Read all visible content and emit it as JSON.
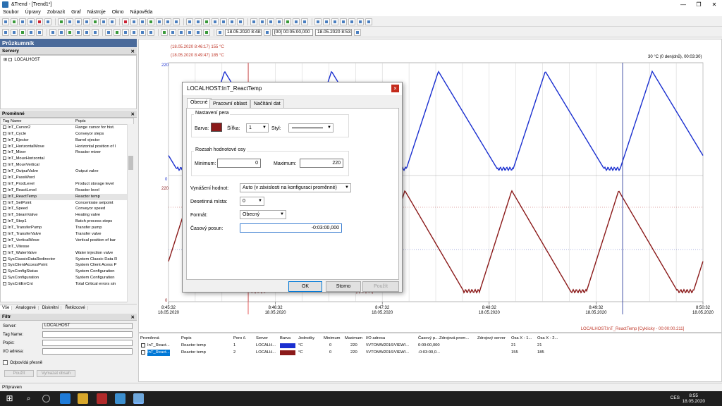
{
  "window": {
    "title": "&Trend - [Trend1*]"
  },
  "menu": [
    "Soubor",
    "Úpravy",
    "Zobrazit",
    "Graf",
    "Nástroje",
    "Okno",
    "Nápověda"
  ],
  "toolbar2": {
    "start_time": "18.05.2020   8:48:32",
    "range": "[00] 00:05:00,000",
    "end_time": "18.05.2020   8:53:32"
  },
  "explorer": {
    "title": "Průzkumník",
    "servers_label": "Servery",
    "server_item": "LOCALHOST",
    "variables_label": "Proměnné",
    "columns": [
      "Tag Name",
      "Popis"
    ],
    "rows": [
      [
        "InT_Cursor2",
        "Range cursor for hist."
      ],
      [
        "InT_Cycle",
        "Conveyor steps"
      ],
      [
        "InT_Ejector",
        "Barrel ejector"
      ],
      [
        "InT_HorizontalMove",
        "Horizontal position of l"
      ],
      [
        "InT_Mixer",
        "Reactor mixer"
      ],
      [
        "InT_MouvHorizontal",
        ""
      ],
      [
        "InT_MouvVertical",
        ""
      ],
      [
        "InT_OutputValve",
        "Output valve"
      ],
      [
        "InT_PassWord",
        ""
      ],
      [
        "InT_ProdLevel",
        "Product storage level"
      ],
      [
        "InT_ReactLevel",
        "Reactor level"
      ],
      [
        "InT_ReactTemp",
        "Reactor temp"
      ],
      [
        "InT_SetPoint",
        "Concentrate setpoint"
      ],
      [
        "InT_Speed",
        "Conveyor speed"
      ],
      [
        "InT_SteamValve",
        "Heating valve"
      ],
      [
        "InT_Step1",
        "Batch process steps"
      ],
      [
        "InT_TransferPump",
        "Transfer pump"
      ],
      [
        "InT_TransferValve",
        "Transfer valve"
      ],
      [
        "InT_VerticalMove",
        "Vertical position of bar"
      ],
      [
        "InT_Vitesse",
        ""
      ],
      [
        "InT_WaterValve",
        "Water injection valve"
      ],
      [
        "SysClassicDataRedirector",
        "System Classic Data R"
      ],
      [
        "SysClientAccessPoint",
        "System Client Acess P"
      ],
      [
        "SysConfigStatus",
        "System Configuration"
      ],
      [
        "SysConfiguration",
        "System Configuration"
      ],
      [
        "SysCritErrCnt",
        "Total Critical errors sin"
      ]
    ],
    "selected_index": 11,
    "tabs": [
      "Vše",
      "Analogové",
      "Diskrétní",
      "Řetězcové"
    ]
  },
  "filter": {
    "title": "Filtr",
    "server_label": "Server:",
    "server_value": "LOCALHOST",
    "tagname_label": "Tag Name:",
    "desc_label": "Popis:",
    "io_label": "I/O adresa:",
    "checkbox_label": "Odpovídá přesně",
    "apply_button": "Použít",
    "clear_button": "Vymazat obsah"
  },
  "chart": {
    "cursor_label_1": "(18.05.2020 8:46:17) 155 °C",
    "cursor_label_2": "(18.05.2020 8:49:47) 185 °C",
    "right_label": "30 °C (0 den(dnů), 00:03:30)",
    "y_top_1": "220",
    "y_bot_1": "0",
    "y_top_2": "220",
    "y_bot_2": "0",
    "x_ticks": [
      [
        "8:45:32",
        "18.05.2020"
      ],
      [
        "8:46:32",
        "18.05.2020"
      ],
      [
        "8:47:32",
        "18.05.2020"
      ],
      [
        "8:48:32",
        "18.05.2020"
      ],
      [
        "8:49:32",
        "18.05.2020"
      ],
      [
        "8:50:32",
        "18.05.2020"
      ]
    ],
    "footer": "LOCALHOST:InT_ReactTemp [Cyklicky - 00:00:00.211]",
    "pen_colors": {
      "blue": "#1a2fd0",
      "red": "#8b1a1a"
    }
  },
  "pens_table": {
    "headers": [
      "Proměnná",
      "Popis",
      "Pero č.",
      "Server",
      "Barva",
      "Jednotky",
      "Minimum",
      "Maximum",
      "I/O adresa",
      "Časový p...",
      "Zdrojová prom...",
      "Zdrojový server",
      "Osa X - 1...",
      "Osa X - 2..."
    ],
    "rows": [
      [
        "InT_React...",
        "Reactor temp",
        "1",
        "LOCALH...",
        "°C",
        "0",
        "220",
        "\\\\VTOMW2016\\VIEWI...",
        "0:00:00,000",
        "21",
        "21"
      ],
      [
        "InT_React...",
        "Reactor temp",
        "2",
        "LOCALH...",
        "°C",
        "0",
        "220",
        "\\\\VTOMW2016\\VIEWI...",
        "-0:03:00,0...",
        "155",
        "185"
      ]
    ]
  },
  "status": "Připraven",
  "taskbar": {
    "lang": "CES",
    "time": "8:55",
    "date": "18.05.2020"
  },
  "dialog": {
    "title": "LOCALHOST:InT_ReactTemp",
    "tabs": [
      "Obecné",
      "Pracovní oblast",
      "Načítání dat"
    ],
    "pen_group": "Nastavení pera",
    "color_label": "Barva:",
    "color_value": "#8b1a1a",
    "width_label": "Šířka:",
    "width_value": "1",
    "style_label": "Styl:",
    "range_group": "Rozsah hodnotové osy",
    "min_label": "Minimum:",
    "min_value": "0",
    "max_label": "Maximum:",
    "max_value": "220",
    "plot_label": "Vynášení hodnot:",
    "plot_value": "Auto (v závislosti na konfiguraci proměnné)",
    "decimals_label": "Desetinná místa:",
    "decimals_value": "0",
    "format_label": "Formát:",
    "format_value": "Obecný",
    "offset_label": "Časový posun:",
    "offset_value": "-0:03:00,000",
    "ok_button": "OK",
    "cancel_button": "Storno",
    "apply_button": "Použít"
  }
}
